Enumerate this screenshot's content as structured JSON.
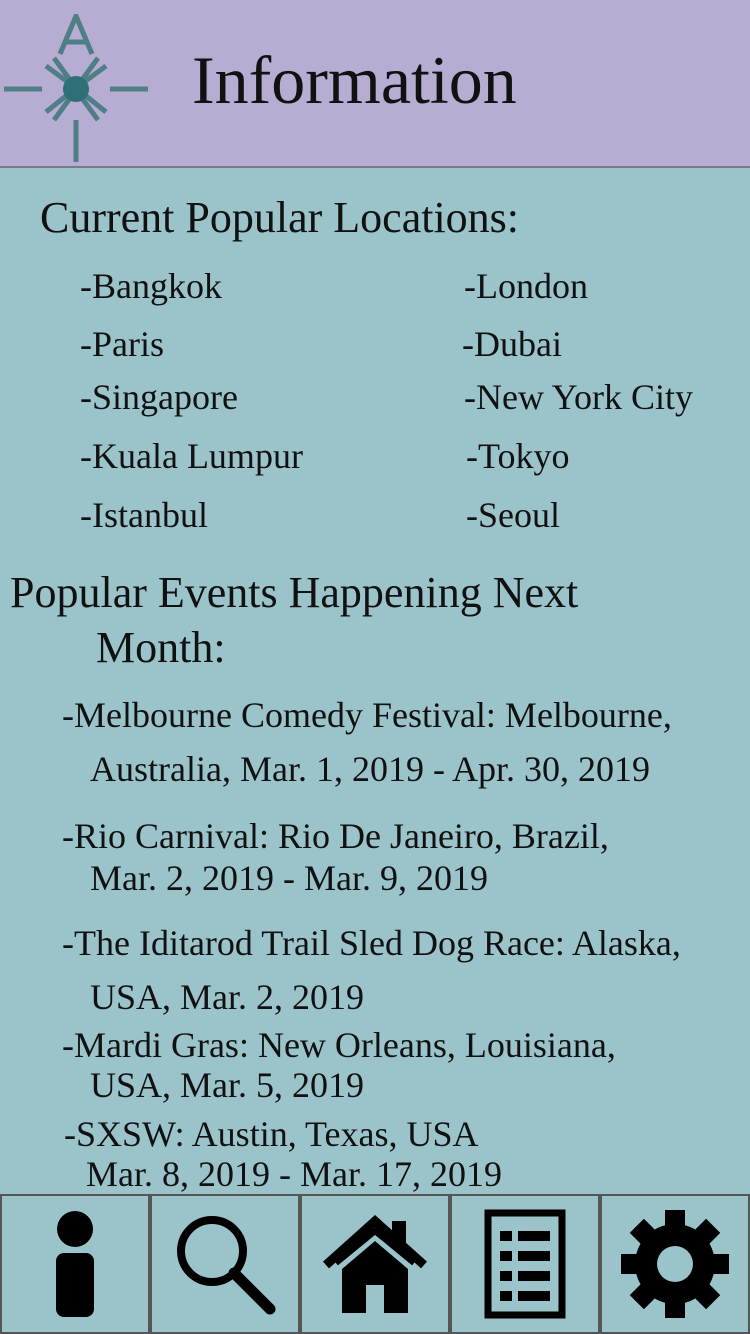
{
  "header": {
    "logo_letters": "A",
    "title": "Information"
  },
  "locations": {
    "heading": "Current Popular Locations:",
    "left": [
      "-Bangkok",
      "-Paris",
      "-Singapore",
      "-Kuala Lumpur",
      "-Istanbul"
    ],
    "right": [
      "-London",
      "-Dubai",
      "-New York City",
      "-Tokyo",
      "-Seoul"
    ]
  },
  "events": {
    "heading_line1": "Popular Events Happening Next",
    "heading_line2": "Month:",
    "items": [
      {
        "line1": "-Melbourne Comedy Festival: Melbourne,",
        "line2": "Australia,  Mar.  1, 2019 - Apr. 30, 2019"
      },
      {
        "line1": "-Rio Carnival: Rio De Janeiro, Brazil,",
        "line2": "Mar.  2, 2019 - Mar. 9, 2019"
      },
      {
        "line1": "-The Iditarod Trail Sled Dog Race: Alaska,",
        "line2": "USA, Mar. 2, 2019"
      },
      {
        "line1": "-Mardi Gras: New Orleans, Louisiana,",
        "line2": "USA, Mar. 5, 2019"
      },
      {
        "line1": "-SXSW: Austin, Texas, USA",
        "line2": "Mar. 8, 2019 - Mar. 17, 2019"
      }
    ]
  },
  "tabbar": {
    "tabs": [
      {
        "icon": "info-icon"
      },
      {
        "icon": "search-icon"
      },
      {
        "icon": "home-icon"
      },
      {
        "icon": "list-icon"
      },
      {
        "icon": "gear-icon"
      }
    ]
  },
  "colors": {
    "header_bg": "#b7acd2",
    "page_bg": "#9bc4ca",
    "logo": "#4d7f85"
  }
}
